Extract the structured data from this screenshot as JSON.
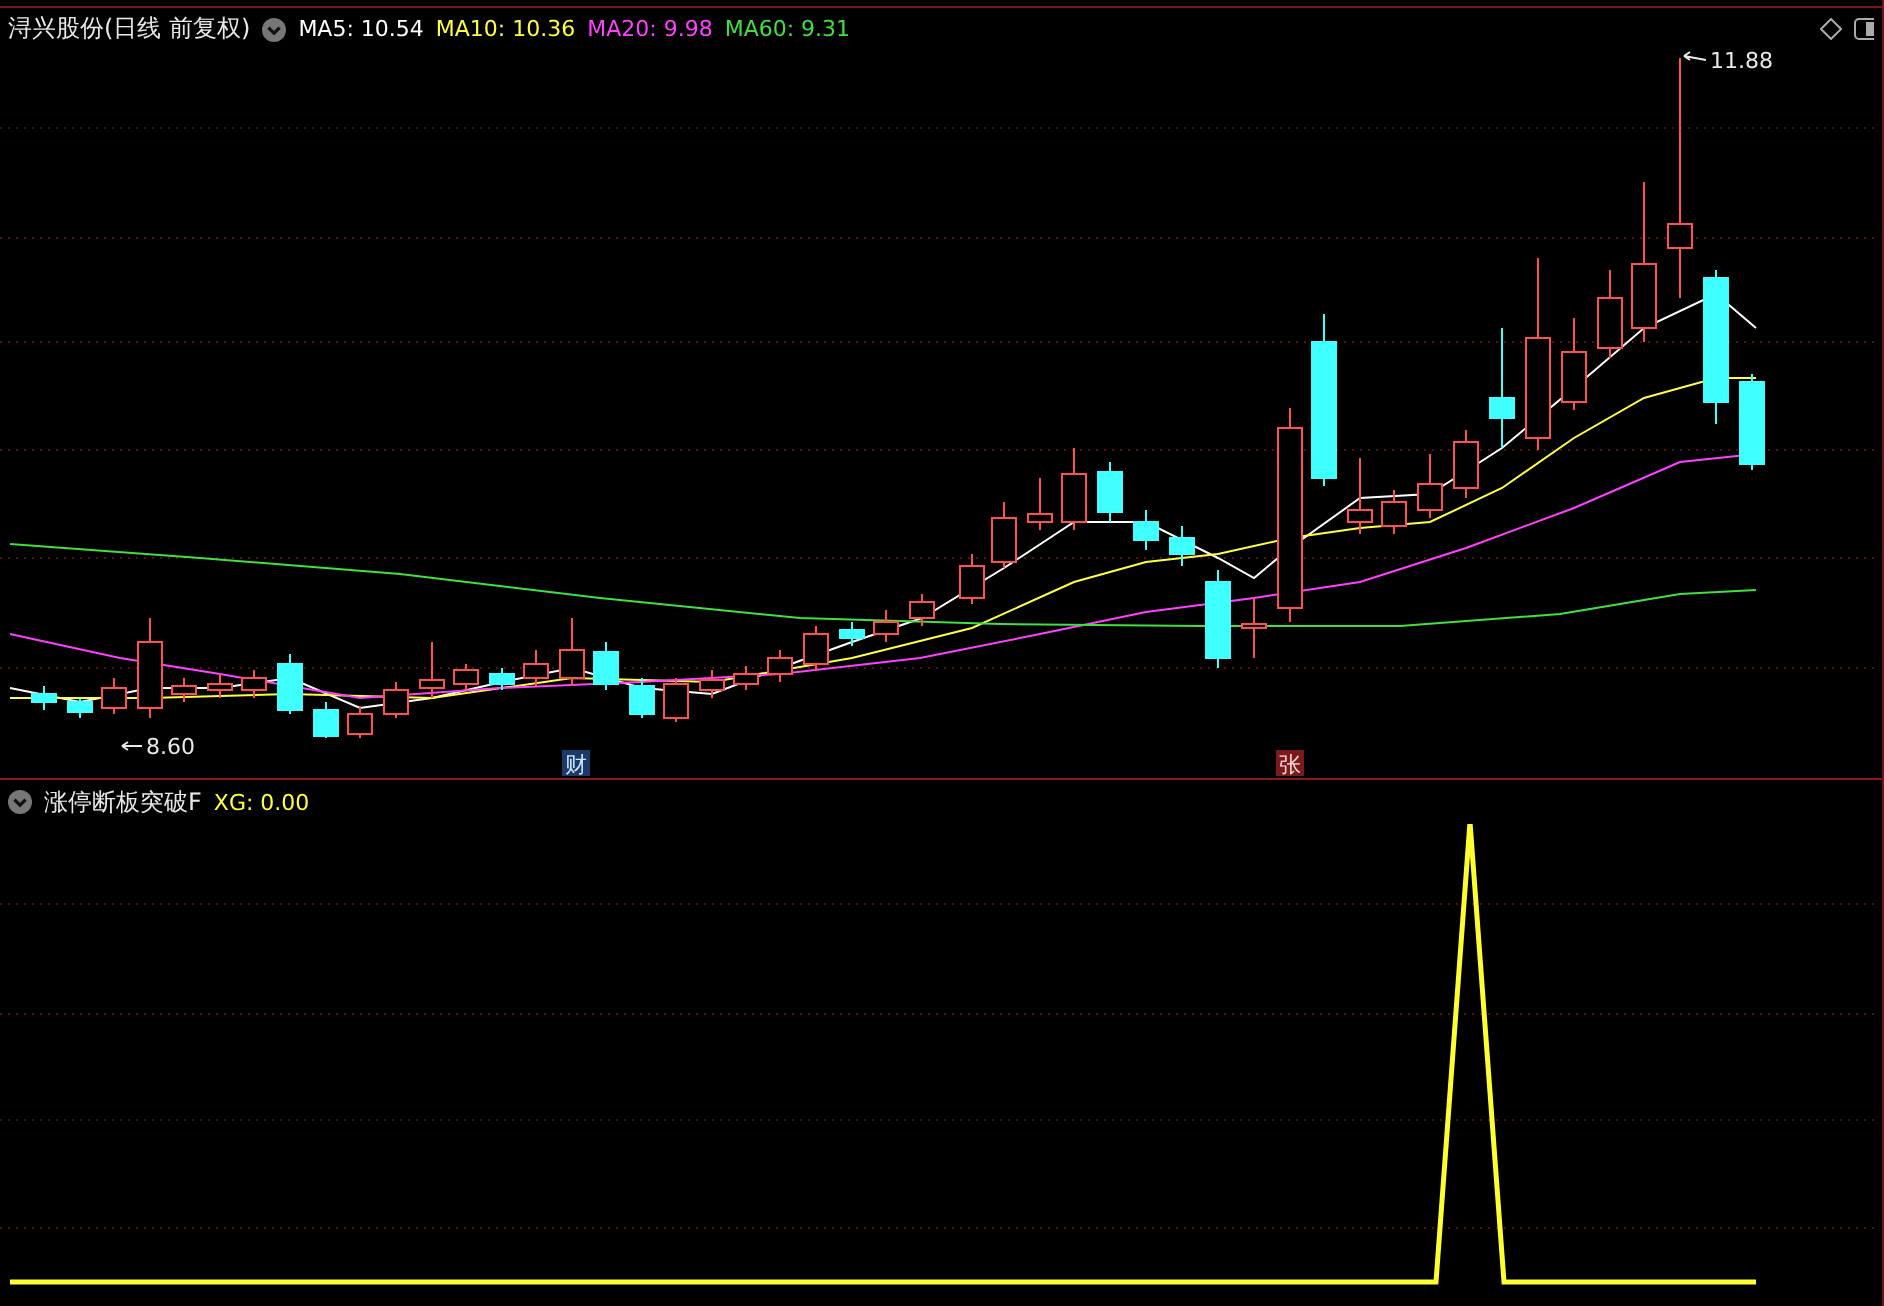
{
  "main_panel": {
    "title": "浔兴股份(日线 前复权)",
    "moving_averages": [
      {
        "label": "MA5: 10.54",
        "color": "#ffffff"
      },
      {
        "label": "MA10: 10.36",
        "color": "#ffff40"
      },
      {
        "label": "MA20: 9.98",
        "color": "#ff40ff"
      },
      {
        "label": "MA60: 9.31",
        "color": "#40e040"
      }
    ],
    "high_label": "11.88",
    "low_label": "8.60",
    "event_markers": [
      {
        "text": "财",
        "kind": "finance"
      },
      {
        "text": "张",
        "kind": "limit"
      }
    ]
  },
  "indicator_panel": {
    "title": "涨停断板突破F",
    "readout": "XG: 0.00"
  }
}
